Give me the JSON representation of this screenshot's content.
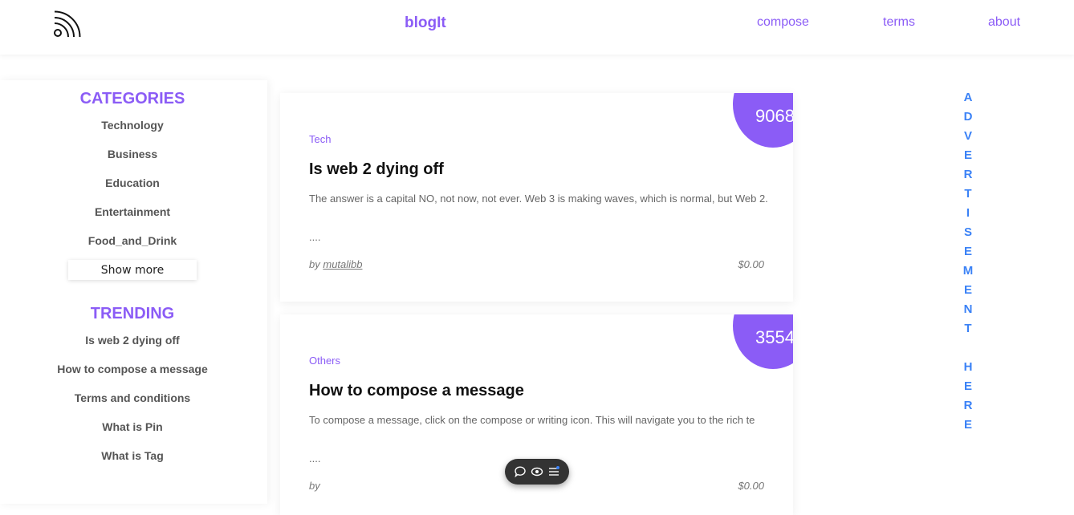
{
  "header": {
    "brand": "blogIt",
    "nav": {
      "compose": "compose",
      "terms": "terms",
      "about": "about"
    }
  },
  "sidebar": {
    "categories_title": "CATEGORIES",
    "categories": [
      "Technology",
      "Business",
      "Education",
      "Entertainment",
      "Food_and_Drink"
    ],
    "show_more": "Show more",
    "trending_title": "TRENDING",
    "trending": [
      "Is web 2 dying off",
      "How to compose a message",
      "Terms and conditions",
      "What is Pin",
      "What is Tag"
    ]
  },
  "posts": [
    {
      "count": "9068",
      "category": "Tech",
      "title": "Is web 2 dying off",
      "excerpt": "The answer is a capital NO, not now, not ever. Web 3 is making waves, which is normal, but Web 2.",
      "ellipsis": "....",
      "by": "by",
      "author": "mutalibb",
      "price": "$0.00"
    },
    {
      "count": "3554",
      "category": "Others",
      "title": "How to compose a message",
      "excerpt": "To compose a message, click on the compose or writing icon. This will navigate you to the rich te",
      "ellipsis": "....",
      "by": "by",
      "author": "",
      "price": "$0.00"
    }
  ],
  "advertisement": [
    "A",
    "D",
    "V",
    "E",
    "R",
    "T",
    "I",
    "S",
    "E",
    "M",
    "E",
    "N",
    "T",
    "",
    "H",
    "E",
    "R",
    "E"
  ],
  "colors": {
    "accent": "#8b5cf6",
    "ad_text": "#3b82f6"
  },
  "icons": [
    "rss-logo-icon",
    "comment-icon",
    "eye-icon",
    "menu-icon"
  ]
}
